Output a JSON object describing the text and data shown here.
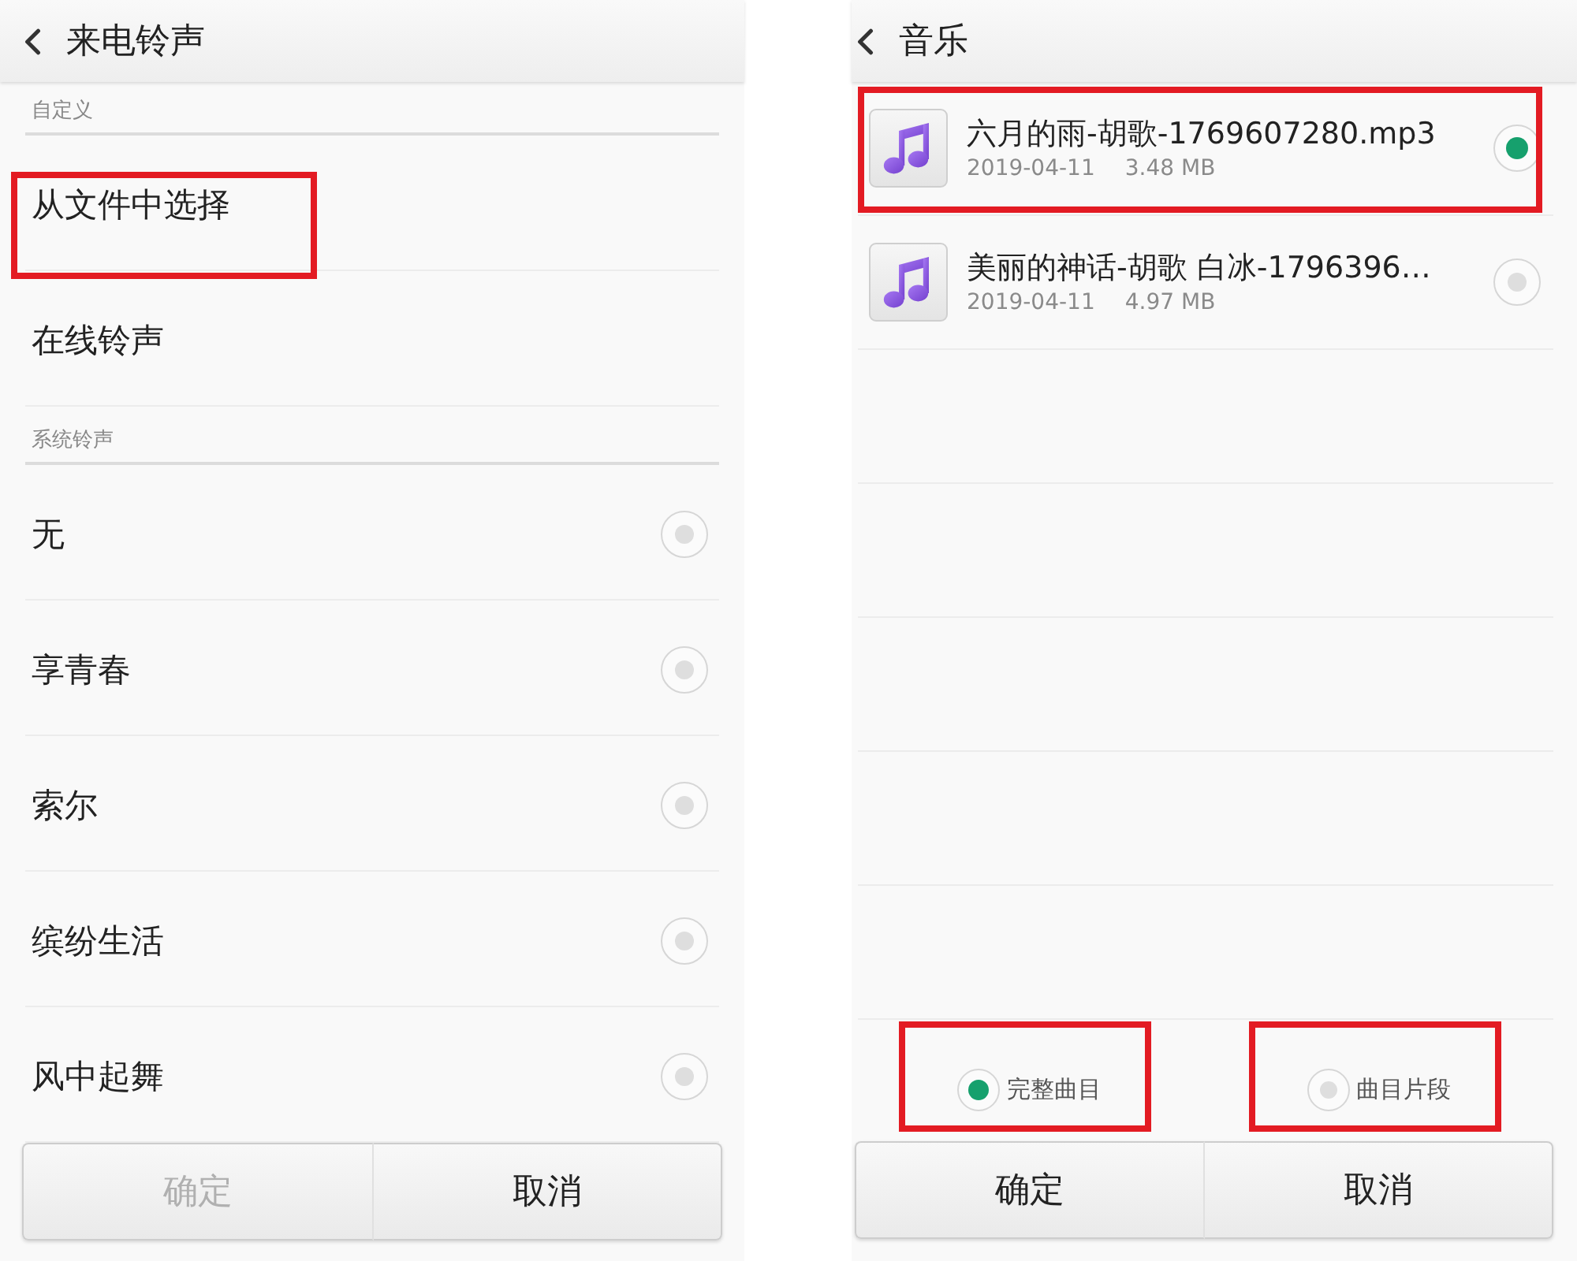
{
  "ringtone_screen": {
    "title": "来电铃声",
    "sections": [
      {
        "label": "自定义",
        "items": [
          {
            "label": "从文件中选择",
            "kind": "link",
            "highlighted": true
          },
          {
            "label": "在线铃声",
            "kind": "link",
            "highlighted": false
          }
        ]
      },
      {
        "label": "系统铃声",
        "items": [
          {
            "label": "无",
            "kind": "radio",
            "selected": false,
            "highlighted": false
          },
          {
            "label": "享青春",
            "kind": "radio",
            "selected": false,
            "highlighted": false
          },
          {
            "label": "索尔",
            "kind": "radio",
            "selected": false,
            "highlighted": false
          },
          {
            "label": "缤纷生活",
            "kind": "radio",
            "selected": false,
            "highlighted": false
          },
          {
            "label": "风中起舞",
            "kind": "radio",
            "selected": false,
            "highlighted": false
          }
        ]
      }
    ],
    "buttons": [
      {
        "label": "确定",
        "disabled": true
      },
      {
        "label": "取消",
        "disabled": false
      }
    ]
  },
  "music_screen": {
    "title": "音乐",
    "files": [
      {
        "name": "六月的雨-胡歌-1769607280.mp3",
        "date": "2019-04-11",
        "size": "3.48 MB",
        "selected": true,
        "highlighted": true
      },
      {
        "name": "美丽的神话-胡歌 白冰-1796396…",
        "date": "2019-04-11",
        "size": "4.97 MB",
        "selected": false,
        "highlighted": false
      }
    ],
    "play_modes": [
      {
        "label": "完整曲目",
        "selected": true,
        "highlighted": true
      },
      {
        "label": "曲目片段",
        "selected": false,
        "highlighted": true
      }
    ],
    "buttons": [
      {
        "label": "确定",
        "disabled": false
      },
      {
        "label": "取消",
        "disabled": false
      }
    ]
  }
}
